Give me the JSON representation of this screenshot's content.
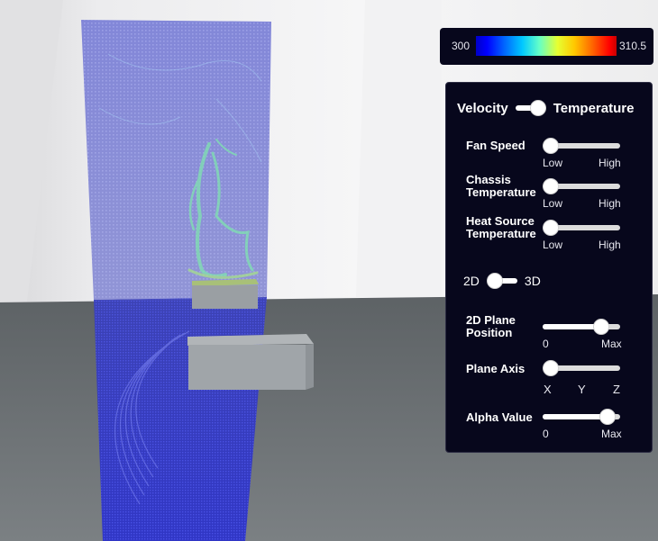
{
  "colorbar": {
    "min_label": "300",
    "max_label": "310.5",
    "colors": [
      "#0000c8",
      "#0064ff",
      "#00c8ff",
      "#e6ff32",
      "#ffc800",
      "#ff6400",
      "#c80000"
    ]
  },
  "mode_toggle": {
    "left_label": "Velocity",
    "right_label": "Temperature",
    "state": "Temperature"
  },
  "controls": {
    "fan_speed": {
      "label": "Fan Speed",
      "min_label": "Low",
      "max_label": "High",
      "value": 0.0
    },
    "chassis_temperature": {
      "label_line1": "Chassis",
      "label_line2": "Temperature",
      "min_label": "Low",
      "max_label": "High",
      "value": 0.0
    },
    "heat_source_temperature": {
      "label_line1": "Heat Source",
      "label_line2": "Temperature",
      "min_label": "Low",
      "max_label": "High",
      "value": 0.0
    }
  },
  "dimension_toggle": {
    "left_label": "2D",
    "right_label": "3D",
    "state": "2D"
  },
  "plane_position": {
    "label_line1": "2D Plane",
    "label_line2": "Position",
    "min_label": "0",
    "max_label": "Max",
    "value": 0.82
  },
  "plane_axis": {
    "label": "Plane Axis",
    "options": [
      "X",
      "Y",
      "Z"
    ],
    "selected": "X"
  },
  "alpha": {
    "label": "Alpha Value",
    "min_label": "0",
    "max_label": "Max",
    "value": 0.92
  },
  "scene_colors": {
    "wall": "#e9e9ea",
    "floor": "#6d7275",
    "plane": "#7c80cf",
    "box": "#9a9fa3",
    "plume": "#7fe3b0"
  }
}
